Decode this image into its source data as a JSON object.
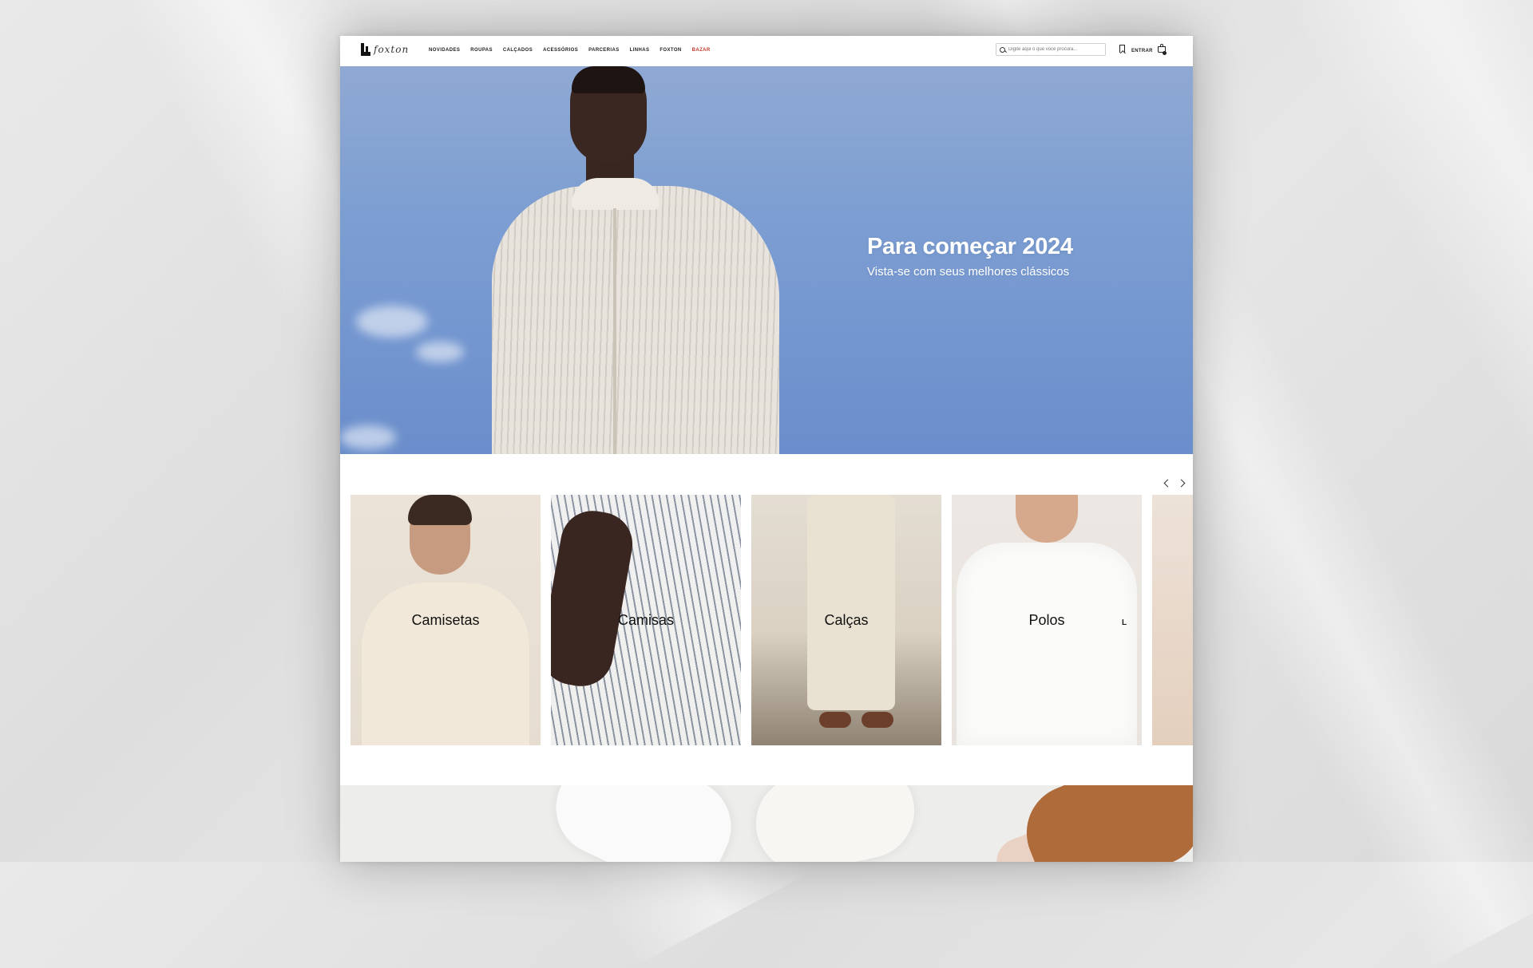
{
  "header": {
    "logo_script": "foxton",
    "nav": [
      {
        "label": "NOVIDADES"
      },
      {
        "label": "ROUPAS"
      },
      {
        "label": "CALÇADOS"
      },
      {
        "label": "ACESSÓRIOS"
      },
      {
        "label": "PARCERIAS"
      },
      {
        "label": "LINHAS"
      },
      {
        "label": "FOXTON"
      },
      {
        "label": "BAZAR",
        "highlight": true
      }
    ],
    "search_placeholder": "Digite aqui o que você procura...",
    "login_label": "ENTRAR",
    "icons": [
      "search-icon",
      "bookmark-icon",
      "cart-icon"
    ]
  },
  "hero": {
    "title": "Para começar 2024",
    "subtitle": "Vista-se com seus melhores clássicos"
  },
  "categories": {
    "items": [
      {
        "label": "Camisetas"
      },
      {
        "label": "Camisas"
      },
      {
        "label": "Calças"
      },
      {
        "label": "Polos"
      },
      {
        "label": ""
      }
    ],
    "polo_logo": "L"
  },
  "colors": {
    "sale": "#c0392b",
    "sky": "#7396d0"
  }
}
